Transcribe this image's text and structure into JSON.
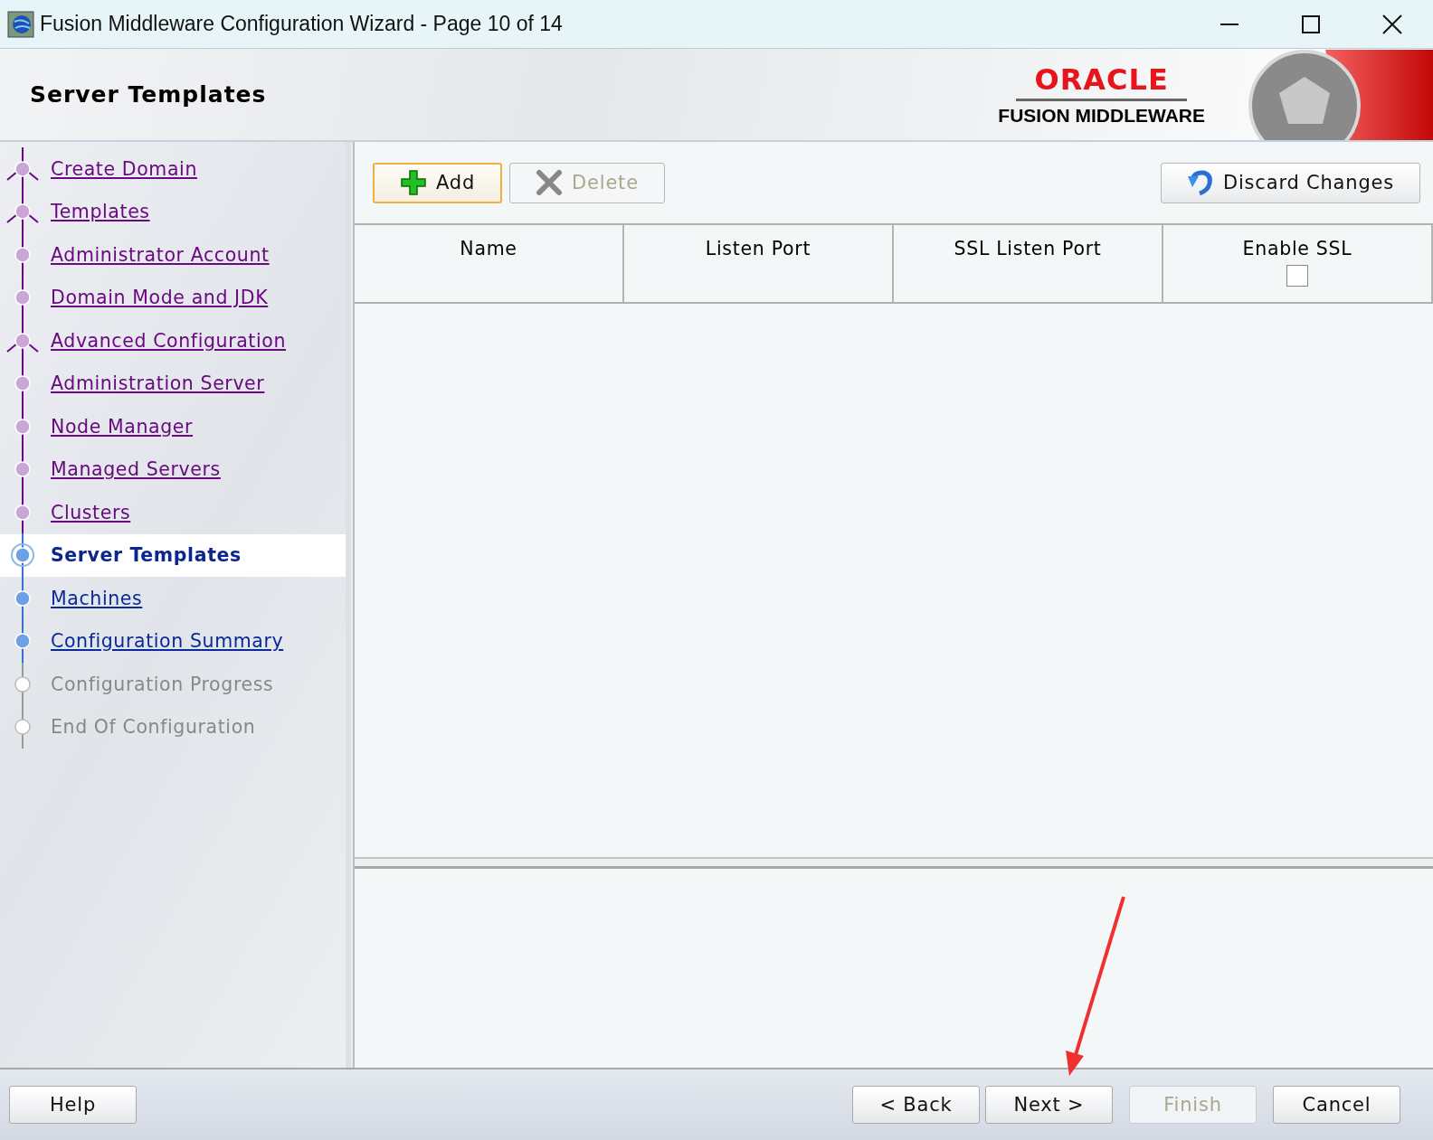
{
  "window": {
    "title": "Fusion Middleware Configuration Wizard - Page 10 of 14"
  },
  "header": {
    "title": "Server Templates",
    "logo": {
      "brand": "ORACLE",
      "product": "FUSION MIDDLEWARE"
    }
  },
  "steps": [
    {
      "label": "Create Domain",
      "visited": true,
      "disabled": false,
      "kind": "branch",
      "selected": false
    },
    {
      "label": "Templates",
      "visited": true,
      "disabled": false,
      "kind": "branch",
      "selected": false
    },
    {
      "label": "Administrator Account",
      "visited": true,
      "disabled": false,
      "kind": "step",
      "selected": false
    },
    {
      "label": "Domain Mode and JDK",
      "visited": true,
      "disabled": false,
      "kind": "step",
      "selected": false
    },
    {
      "label": "Advanced Configuration",
      "visited": true,
      "disabled": false,
      "kind": "branch",
      "selected": false
    },
    {
      "label": "Administration Server",
      "visited": true,
      "disabled": false,
      "kind": "step",
      "selected": false
    },
    {
      "label": "Node Manager",
      "visited": true,
      "disabled": false,
      "kind": "step",
      "selected": false
    },
    {
      "label": "Managed Servers",
      "visited": true,
      "disabled": false,
      "kind": "step",
      "selected": false
    },
    {
      "label": "Clusters",
      "visited": true,
      "disabled": false,
      "kind": "step",
      "selected": false
    },
    {
      "label": "Server Templates",
      "visited": false,
      "disabled": false,
      "kind": "step",
      "selected": true
    },
    {
      "label": "Machines",
      "visited": false,
      "disabled": false,
      "kind": "step",
      "selected": false
    },
    {
      "label": "Configuration Summary",
      "visited": false,
      "disabled": false,
      "kind": "step",
      "selected": false
    },
    {
      "label": "Configuration Progress",
      "visited": false,
      "disabled": true,
      "kind": "step",
      "selected": false
    },
    {
      "label": "End Of Configuration",
      "visited": false,
      "disabled": true,
      "kind": "step",
      "selected": false
    }
  ],
  "toolbar": {
    "add": {
      "label": "Add",
      "focused": true,
      "disabled": false
    },
    "delete": {
      "label": "Delete",
      "focused": false,
      "disabled": true
    },
    "discard": {
      "label": "Discard Changes",
      "disabled": false
    }
  },
  "table": {
    "columns": [
      {
        "label": "Name"
      },
      {
        "label": "Listen Port"
      },
      {
        "label": "SSL Listen Port"
      },
      {
        "label": "Enable SSL",
        "checkbox": {
          "checked": false
        }
      }
    ]
  },
  "buttons": {
    "help": {
      "label": "Help",
      "disabled": false
    },
    "back": {
      "label": "< Back",
      "disabled": false
    },
    "next": {
      "label": "Next >",
      "disabled": false
    },
    "finish": {
      "label": "Finish",
      "disabled": true
    },
    "cancel": {
      "label": "Cancel",
      "disabled": false
    }
  }
}
